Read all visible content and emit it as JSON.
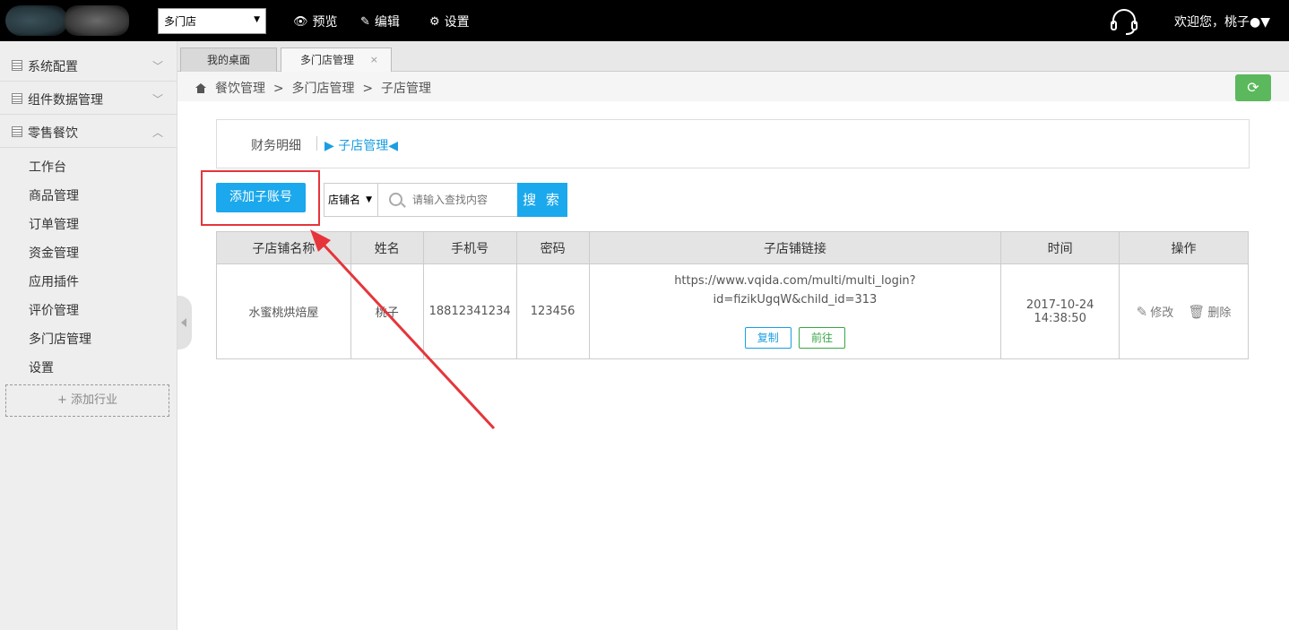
{
  "header": {
    "store_select": "多门店",
    "nav": [
      {
        "label": "预览",
        "icon": "eye-icon"
      },
      {
        "label": "编辑",
        "icon": "edit-icon"
      },
      {
        "label": "设置",
        "icon": "gear-icon"
      }
    ],
    "welcome": "欢迎您，桃子"
  },
  "sidebar": {
    "groups": [
      {
        "label": "系统配置"
      },
      {
        "label": "组件数据管理"
      },
      {
        "label": "零售餐饮"
      }
    ],
    "items": [
      "工作台",
      "商品管理",
      "订单管理",
      "资金管理",
      "应用插件",
      "评价管理",
      "多门店管理",
      "设置"
    ],
    "add_industry": "+ 添加行业"
  },
  "tabs": [
    {
      "label": "我的桌面"
    },
    {
      "label": "多门店管理",
      "close": "×"
    }
  ],
  "breadcrumb": "餐饮管理  >  多门店管理  >  子店管理",
  "subtabs": {
    "first": "财务明细",
    "second": "子店管理"
  },
  "toolbar": {
    "add_button": "添加子账号",
    "search_category": "店铺名",
    "search_placeholder": "请输入查找内容",
    "search_button": "搜 索"
  },
  "table": {
    "headers": [
      "子店铺名称",
      "姓名",
      "手机号",
      "密码",
      "子店铺链接",
      "时间",
      "操作"
    ],
    "rows": [
      {
        "store_name": "水蜜桃烘焙屋",
        "name": "桃子",
        "phone": "18812341234",
        "password": "123456",
        "link_line1": "https://www.vqida.com/multi/multi_login?",
        "link_line2": "id=fizikUgqW&child_id=313",
        "copy_label": "复制",
        "go_label": "前往",
        "time": "2017-10-24 14:38:50",
        "edit_label": "修改",
        "delete_label": "删除"
      }
    ]
  },
  "colors": {
    "accent": "#1ba8ec",
    "success": "#5cb85c",
    "highlight": "#e5353b",
    "topbar": "#000000"
  }
}
